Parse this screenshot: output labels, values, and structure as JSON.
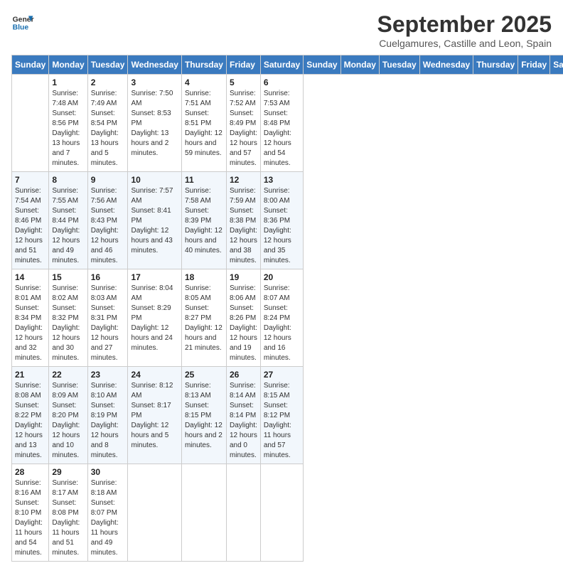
{
  "header": {
    "logo_line1": "General",
    "logo_line2": "Blue",
    "month": "September 2025",
    "location": "Cuelgamures, Castille and Leon, Spain"
  },
  "weekdays": [
    "Sunday",
    "Monday",
    "Tuesday",
    "Wednesday",
    "Thursday",
    "Friday",
    "Saturday"
  ],
  "weeks": [
    [
      {
        "day": "",
        "sunrise": "",
        "sunset": "",
        "daylight": ""
      },
      {
        "day": "1",
        "sunrise": "Sunrise: 7:48 AM",
        "sunset": "Sunset: 8:56 PM",
        "daylight": "Daylight: 13 hours and 7 minutes."
      },
      {
        "day": "2",
        "sunrise": "Sunrise: 7:49 AM",
        "sunset": "Sunset: 8:54 PM",
        "daylight": "Daylight: 13 hours and 5 minutes."
      },
      {
        "day": "3",
        "sunrise": "Sunrise: 7:50 AM",
        "sunset": "Sunset: 8:53 PM",
        "daylight": "Daylight: 13 hours and 2 minutes."
      },
      {
        "day": "4",
        "sunrise": "Sunrise: 7:51 AM",
        "sunset": "Sunset: 8:51 PM",
        "daylight": "Daylight: 12 hours and 59 minutes."
      },
      {
        "day": "5",
        "sunrise": "Sunrise: 7:52 AM",
        "sunset": "Sunset: 8:49 PM",
        "daylight": "Daylight: 12 hours and 57 minutes."
      },
      {
        "day": "6",
        "sunrise": "Sunrise: 7:53 AM",
        "sunset": "Sunset: 8:48 PM",
        "daylight": "Daylight: 12 hours and 54 minutes."
      }
    ],
    [
      {
        "day": "7",
        "sunrise": "Sunrise: 7:54 AM",
        "sunset": "Sunset: 8:46 PM",
        "daylight": "Daylight: 12 hours and 51 minutes."
      },
      {
        "day": "8",
        "sunrise": "Sunrise: 7:55 AM",
        "sunset": "Sunset: 8:44 PM",
        "daylight": "Daylight: 12 hours and 49 minutes."
      },
      {
        "day": "9",
        "sunrise": "Sunrise: 7:56 AM",
        "sunset": "Sunset: 8:43 PM",
        "daylight": "Daylight: 12 hours and 46 minutes."
      },
      {
        "day": "10",
        "sunrise": "Sunrise: 7:57 AM",
        "sunset": "Sunset: 8:41 PM",
        "daylight": "Daylight: 12 hours and 43 minutes."
      },
      {
        "day": "11",
        "sunrise": "Sunrise: 7:58 AM",
        "sunset": "Sunset: 8:39 PM",
        "daylight": "Daylight: 12 hours and 40 minutes."
      },
      {
        "day": "12",
        "sunrise": "Sunrise: 7:59 AM",
        "sunset": "Sunset: 8:38 PM",
        "daylight": "Daylight: 12 hours and 38 minutes."
      },
      {
        "day": "13",
        "sunrise": "Sunrise: 8:00 AM",
        "sunset": "Sunset: 8:36 PM",
        "daylight": "Daylight: 12 hours and 35 minutes."
      }
    ],
    [
      {
        "day": "14",
        "sunrise": "Sunrise: 8:01 AM",
        "sunset": "Sunset: 8:34 PM",
        "daylight": "Daylight: 12 hours and 32 minutes."
      },
      {
        "day": "15",
        "sunrise": "Sunrise: 8:02 AM",
        "sunset": "Sunset: 8:32 PM",
        "daylight": "Daylight: 12 hours and 30 minutes."
      },
      {
        "day": "16",
        "sunrise": "Sunrise: 8:03 AM",
        "sunset": "Sunset: 8:31 PM",
        "daylight": "Daylight: 12 hours and 27 minutes."
      },
      {
        "day": "17",
        "sunrise": "Sunrise: 8:04 AM",
        "sunset": "Sunset: 8:29 PM",
        "daylight": "Daylight: 12 hours and 24 minutes."
      },
      {
        "day": "18",
        "sunrise": "Sunrise: 8:05 AM",
        "sunset": "Sunset: 8:27 PM",
        "daylight": "Daylight: 12 hours and 21 minutes."
      },
      {
        "day": "19",
        "sunrise": "Sunrise: 8:06 AM",
        "sunset": "Sunset: 8:26 PM",
        "daylight": "Daylight: 12 hours and 19 minutes."
      },
      {
        "day": "20",
        "sunrise": "Sunrise: 8:07 AM",
        "sunset": "Sunset: 8:24 PM",
        "daylight": "Daylight: 12 hours and 16 minutes."
      }
    ],
    [
      {
        "day": "21",
        "sunrise": "Sunrise: 8:08 AM",
        "sunset": "Sunset: 8:22 PM",
        "daylight": "Daylight: 12 hours and 13 minutes."
      },
      {
        "day": "22",
        "sunrise": "Sunrise: 8:09 AM",
        "sunset": "Sunset: 8:20 PM",
        "daylight": "Daylight: 12 hours and 10 minutes."
      },
      {
        "day": "23",
        "sunrise": "Sunrise: 8:10 AM",
        "sunset": "Sunset: 8:19 PM",
        "daylight": "Daylight: 12 hours and 8 minutes."
      },
      {
        "day": "24",
        "sunrise": "Sunrise: 8:12 AM",
        "sunset": "Sunset: 8:17 PM",
        "daylight": "Daylight: 12 hours and 5 minutes."
      },
      {
        "day": "25",
        "sunrise": "Sunrise: 8:13 AM",
        "sunset": "Sunset: 8:15 PM",
        "daylight": "Daylight: 12 hours and 2 minutes."
      },
      {
        "day": "26",
        "sunrise": "Sunrise: 8:14 AM",
        "sunset": "Sunset: 8:14 PM",
        "daylight": "Daylight: 12 hours and 0 minutes."
      },
      {
        "day": "27",
        "sunrise": "Sunrise: 8:15 AM",
        "sunset": "Sunset: 8:12 PM",
        "daylight": "Daylight: 11 hours and 57 minutes."
      }
    ],
    [
      {
        "day": "28",
        "sunrise": "Sunrise: 8:16 AM",
        "sunset": "Sunset: 8:10 PM",
        "daylight": "Daylight: 11 hours and 54 minutes."
      },
      {
        "day": "29",
        "sunrise": "Sunrise: 8:17 AM",
        "sunset": "Sunset: 8:08 PM",
        "daylight": "Daylight: 11 hours and 51 minutes."
      },
      {
        "day": "30",
        "sunrise": "Sunrise: 8:18 AM",
        "sunset": "Sunset: 8:07 PM",
        "daylight": "Daylight: 11 hours and 49 minutes."
      },
      {
        "day": "",
        "sunrise": "",
        "sunset": "",
        "daylight": ""
      },
      {
        "day": "",
        "sunrise": "",
        "sunset": "",
        "daylight": ""
      },
      {
        "day": "",
        "sunrise": "",
        "sunset": "",
        "daylight": ""
      },
      {
        "day": "",
        "sunrise": "",
        "sunset": "",
        "daylight": ""
      }
    ]
  ]
}
